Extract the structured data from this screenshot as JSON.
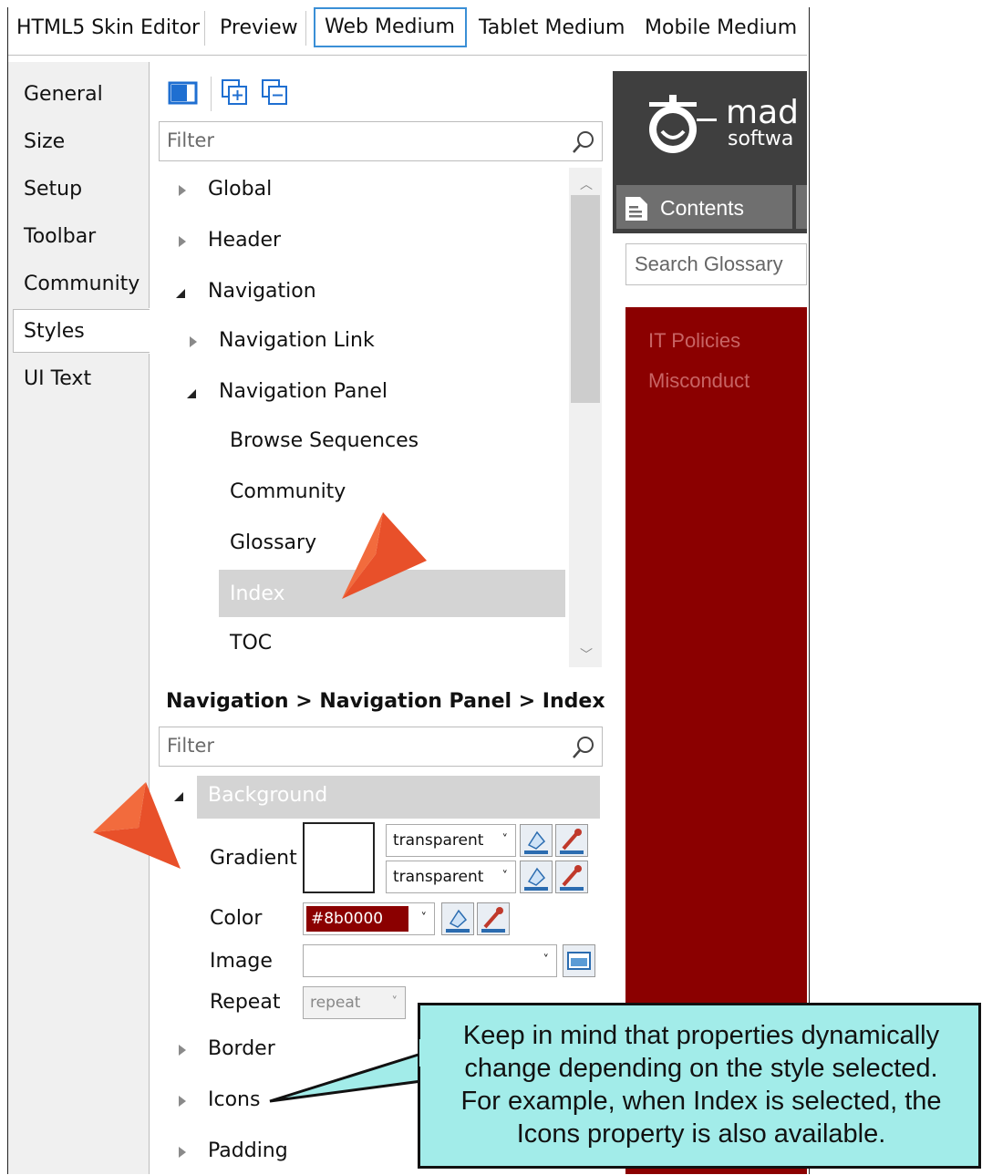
{
  "top_tabs": [
    "HTML5 Skin Editor",
    "Preview",
    "Web Medium",
    "Tablet Medium",
    "Mobile Medium"
  ],
  "left_tabs": [
    "General",
    "Size",
    "Setup",
    "Toolbar",
    "Community",
    "Styles",
    "UI Text"
  ],
  "style_filter": {
    "placeholder": "Filter"
  },
  "tree": {
    "global": "Global",
    "header": "Header",
    "navigation": "Navigation",
    "nav_link": "Navigation Link",
    "nav_panel": "Navigation Panel",
    "browse": "Browse Sequences",
    "community": "Community",
    "glossary": "Glossary",
    "index": "Index",
    "toc": "TOC"
  },
  "breadcrumb": "Navigation > Navigation Panel > Index",
  "prop_filter": {
    "placeholder": "Filter"
  },
  "properties": {
    "background": "Background",
    "gradient": "Gradient",
    "gradient_from": "transparent",
    "gradient_to": "transparent",
    "color": "Color",
    "color_value": "#8b0000",
    "image": "Image",
    "repeat": "Repeat",
    "repeat_value": "repeat",
    "border": "Border",
    "icons": "Icons",
    "padding": "Padding"
  },
  "preview": {
    "logo_line1": "mad",
    "logo_line2": "softwa",
    "contents_tab": "Contents",
    "search_placeholder": "Search Glossary",
    "links": [
      "IT Policies",
      "Misconduct"
    ],
    "brand_color": "#8b0000"
  },
  "callout": {
    "lines": [
      "Keep in mind that properties dynamically",
      "change depending on the style selected.",
      "For example, when Index is selected, the",
      "Icons property is also available."
    ]
  },
  "colors": {
    "accent_arrow": "#e8502a",
    "selection": "#d4d4d4",
    "callout_bg": "#a2ece9"
  }
}
